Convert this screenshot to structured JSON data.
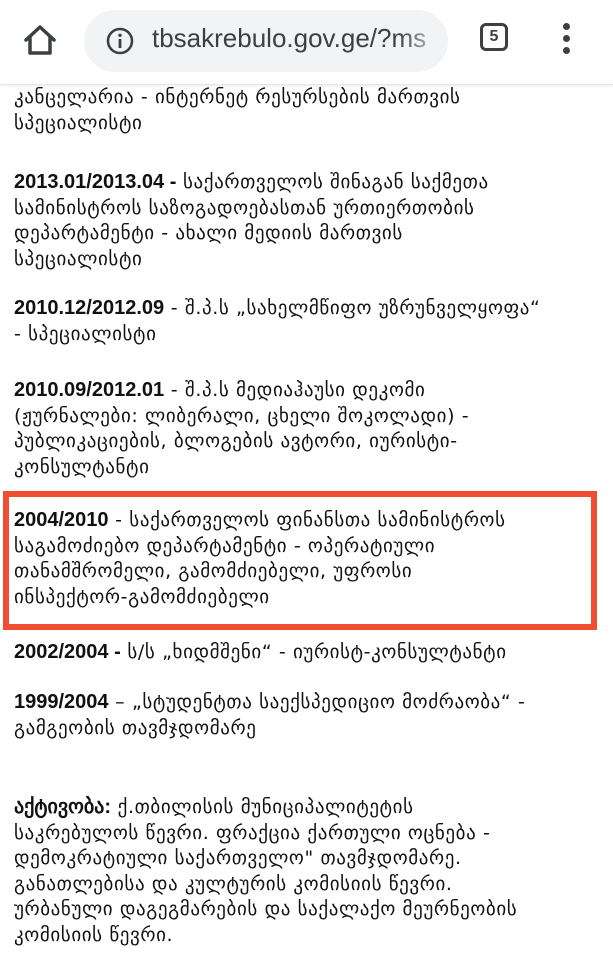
{
  "browser": {
    "url": "tbsakrebulo.gov.ge/?ms",
    "tab_count": "5",
    "accent_color": "#ef4e32"
  },
  "entries": [
    {
      "date": "",
      "sep": "",
      "lines": [
        "კანცელარია - ინტერნეტ რესურსების მართვის",
        "სპეციალისტი"
      ]
    },
    {
      "date": "2013.01/2013.04 -",
      "sep": " ",
      "lines": [
        "საქართველოს შინაგან საქმეთა",
        "სამინისტროს საზოგადოებასთან ურთიერთობის",
        "დეპარტამენტი - ახალი მედიის მართვის",
        "სპეციალისტი"
      ]
    },
    {
      "date": "2010.12/2012.09",
      "sep": " - ",
      "lines": [
        "შ.პ.ს „სახელმწიფო უზრუნველყოფა“",
        "- სპეციალისტი"
      ]
    },
    {
      "date": "2010.09/2012.01",
      "sep": " - ",
      "lines": [
        "შ.პ.ს მედიაჰაუსი დეკომი",
        "(ჟურნალები: ლიბერალი, ცხელი შოკოლადი) -",
        "პუბლიკაციების, ბლოგების ავტორი, იურისტი-",
        "კონსულტანტი"
      ]
    },
    {
      "date": "2004/2010",
      "sep": " - ",
      "lines": [
        "საქართველოს ფინანსთა სამინისტროს",
        "საგამოძიებო დეპარტამენტი - ოპერატიული",
        "თანამშრომელი, გამომძიებელი, უფროსი",
        "ინსპექტორ-გამომძიებელი"
      ]
    },
    {
      "date": "2002/2004 -",
      "sep": " ",
      "lines": [
        "ს/ს „ხიდმშენი“ - იურისტ-კონსულტანტი"
      ]
    },
    {
      "date": "1999/2004",
      "sep": " – ",
      "lines": [
        "„სტუდენტთა საექსპედიციო მოძრაობა“ -",
        "გამგეობის თავმჯდომარე"
      ]
    },
    {
      "date": "აქტივობა:",
      "sep": " ",
      "lines": [
        "ქ.თბილისის მუნიციპალიტეტის",
        "საკრებულოს წევრი. ფრაქცია ქართული ოცნება -",
        "დემოკრატიული საქართველო\" თავმჯდომარე.",
        "განათლებისა და კულტურის კომისიის წევრი.",
        "ურბანული დაგეგმარების და საქალაქო მეურნეობის",
        "კომისიის წევრი."
      ]
    }
  ]
}
